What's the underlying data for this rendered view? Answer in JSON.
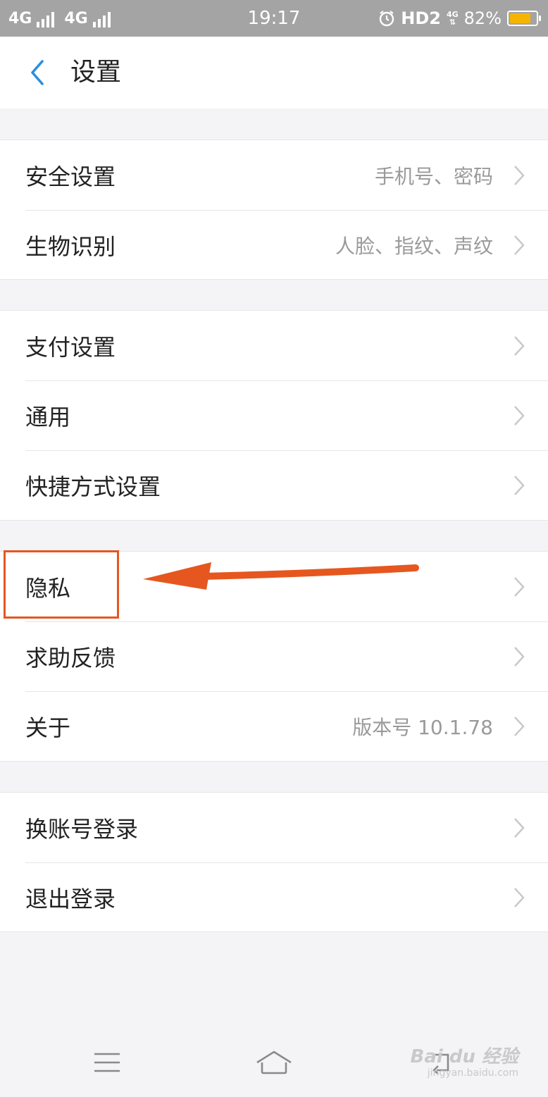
{
  "status_bar": {
    "net1": "4G",
    "net2": "4G",
    "time": "19:17",
    "hd": "HD2",
    "net_mini": "4G",
    "battery": "82%",
    "battery_level": 0.82,
    "battery_color": "#f5b400"
  },
  "header": {
    "title": "设置",
    "back_icon": "chevron-left-icon",
    "accent": "#2a8fde"
  },
  "groups": [
    [
      {
        "label": "安全设置",
        "value": "手机号、密码"
      },
      {
        "label": "生物识别",
        "value": "人脸、指纹、声纹"
      }
    ],
    [
      {
        "label": "支付设置",
        "value": ""
      },
      {
        "label": "通用",
        "value": ""
      },
      {
        "label": "快捷方式设置",
        "value": ""
      }
    ],
    [
      {
        "label": "隐私",
        "value": ""
      },
      {
        "label": "求助反馈",
        "value": ""
      },
      {
        "label": "关于",
        "value": "版本号 10.1.78"
      }
    ],
    [
      {
        "label": "换账号登录",
        "value": ""
      },
      {
        "label": "退出登录",
        "value": ""
      }
    ]
  ],
  "annotation": {
    "color": "#e5571f",
    "target": "隐私"
  },
  "bottom_nav": {
    "items": [
      "menu-icon",
      "home-icon",
      "back-icon"
    ]
  },
  "watermark": {
    "text": "Bai du 经验",
    "sub": "jingyan.baidu.com"
  }
}
